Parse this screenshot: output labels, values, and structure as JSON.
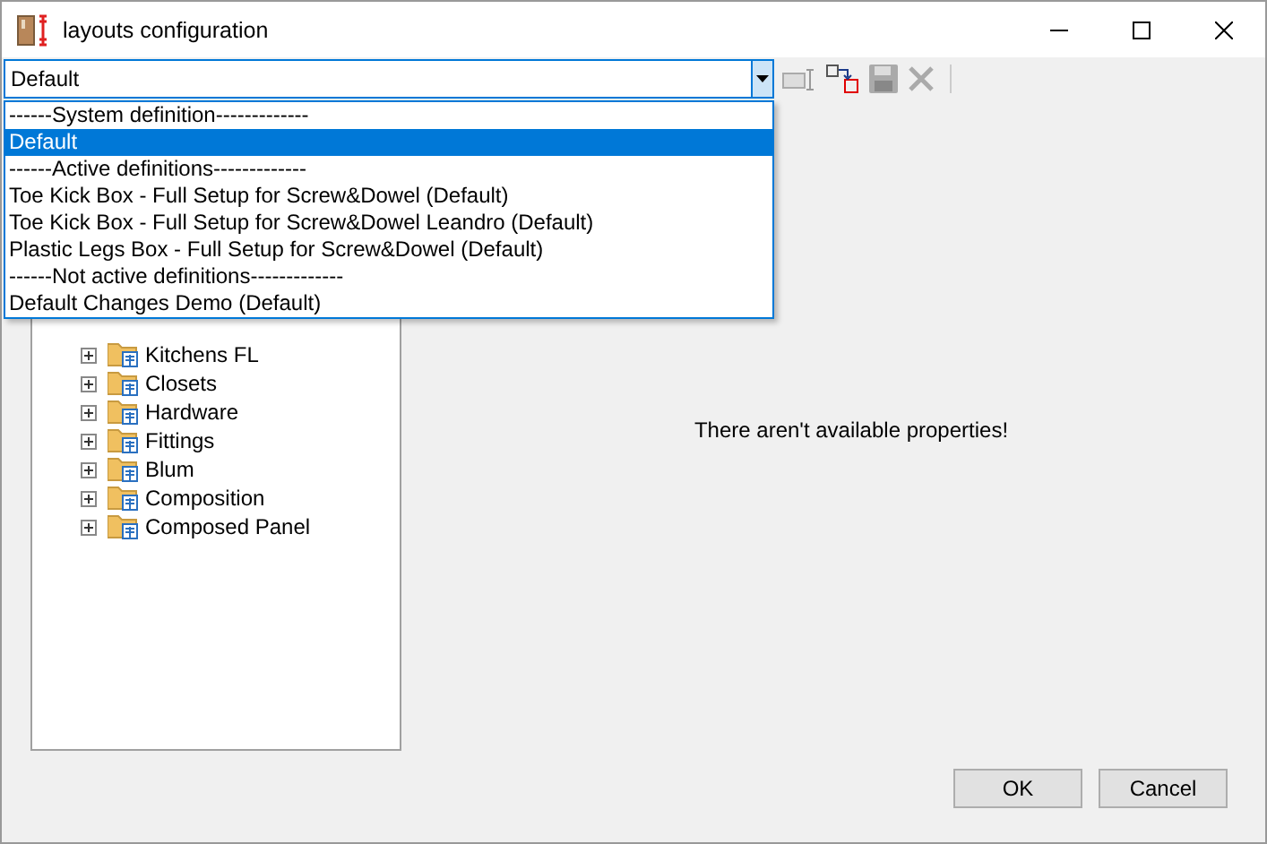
{
  "window": {
    "title": "layouts configuration"
  },
  "combo": {
    "value": "Default",
    "expanded": true
  },
  "dropdown": [
    {
      "label": "------System definition-------------",
      "selected": false
    },
    {
      "label": "Default",
      "selected": true
    },
    {
      "label": "------Active definitions-------------",
      "selected": false
    },
    {
      "label": "Toe Kick Box - Full Setup for Screw&Dowel (Default)",
      "selected": false
    },
    {
      "label": "Toe Kick Box - Full Setup for Screw&Dowel Leandro (Default)",
      "selected": false
    },
    {
      "label": "Plastic Legs Box - Full Setup for Screw&Dowel (Default)",
      "selected": false
    },
    {
      "label": "------Not active definitions-------------",
      "selected": false
    },
    {
      "label": "Default Changes Demo (Default)",
      "selected": false
    }
  ],
  "tree": [
    {
      "label": "Kitchens FL",
      "expanded": false
    },
    {
      "label": "Closets",
      "expanded": false
    },
    {
      "label": "Hardware",
      "expanded": false
    },
    {
      "label": "Fittings",
      "expanded": false
    },
    {
      "label": "Blum",
      "expanded": false
    },
    {
      "label": "Composition",
      "expanded": false
    },
    {
      "label": "Composed Panel",
      "expanded": false
    }
  ],
  "properties_message": "There aren't available properties!",
  "buttons": [
    "OK",
    "Cancel"
  ]
}
